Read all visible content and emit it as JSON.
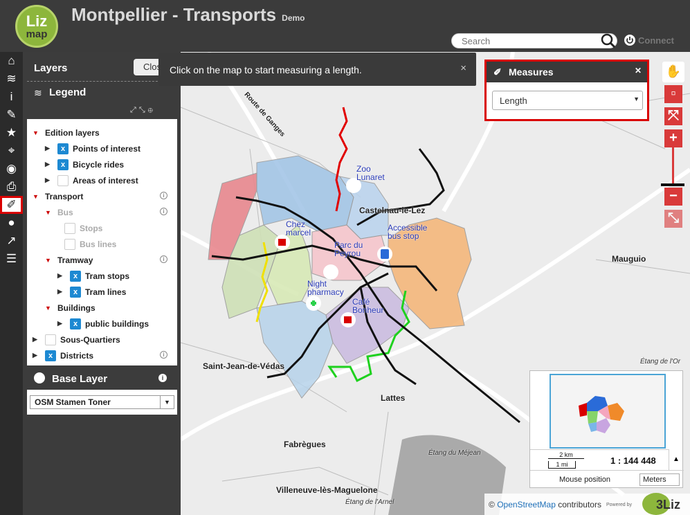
{
  "header": {
    "logo_top": "Liz",
    "logo_bottom": "map",
    "title": "Montpellier - Transports",
    "title_tag": "Demo",
    "search_placeholder": "Search",
    "connect_label": "Connect"
  },
  "toolbar": {
    "items": [
      {
        "icon": "home-icon",
        "glyph": "⌂"
      },
      {
        "icon": "layers-icon",
        "glyph": "≋"
      },
      {
        "icon": "info-icon",
        "glyph": "i"
      },
      {
        "icon": "edit-icon",
        "glyph": "✎"
      },
      {
        "icon": "star-icon",
        "glyph": "★"
      },
      {
        "icon": "locate-icon",
        "glyph": "⌖"
      },
      {
        "icon": "geolocation-icon",
        "glyph": "◉"
      },
      {
        "icon": "print-icon",
        "glyph": "⎙"
      },
      {
        "icon": "measure-icon",
        "glyph": "✐"
      },
      {
        "icon": "comment-icon",
        "glyph": "●"
      },
      {
        "icon": "share-icon",
        "glyph": "↗"
      },
      {
        "icon": "list-icon",
        "glyph": "☰"
      }
    ]
  },
  "panel": {
    "layers_title": "Layers",
    "close_label": "Close",
    "legend_title": "Legend",
    "tree": [
      {
        "label": "Edition layers",
        "indent": 0,
        "tri": "open",
        "checkbox": null,
        "info": false,
        "grey": false
      },
      {
        "label": "Points of interest",
        "indent": 1,
        "tri": "closed",
        "checkbox": true,
        "info": false,
        "grey": false
      },
      {
        "label": "Bicycle rides",
        "indent": 1,
        "tri": "closed",
        "checkbox": true,
        "info": false,
        "grey": false
      },
      {
        "label": "Areas of interest",
        "indent": 1,
        "tri": "closed",
        "checkbox": false,
        "info": false,
        "grey": false
      },
      {
        "label": "Transport",
        "indent": 0,
        "tri": "open",
        "checkbox": null,
        "info": true,
        "grey": false
      },
      {
        "label": "Bus",
        "indent": 1,
        "tri": "open",
        "checkbox": null,
        "info": true,
        "grey": true
      },
      {
        "label": "Stops",
        "indent": 2,
        "tri": "none",
        "checkbox": false,
        "info": false,
        "grey": true
      },
      {
        "label": "Bus lines",
        "indent": 2,
        "tri": "none",
        "checkbox": false,
        "info": false,
        "grey": true
      },
      {
        "label": "Tramway",
        "indent": 1,
        "tri": "open",
        "checkbox": null,
        "info": true,
        "grey": false
      },
      {
        "label": "Tram stops",
        "indent": 2,
        "tri": "closed",
        "checkbox": true,
        "info": false,
        "grey": false
      },
      {
        "label": "Tram lines",
        "indent": 2,
        "tri": "closed",
        "checkbox": true,
        "info": false,
        "grey": false
      },
      {
        "label": "Buildings",
        "indent": 1,
        "tri": "open",
        "checkbox": null,
        "info": false,
        "grey": false
      },
      {
        "label": "public buildings",
        "indent": 2,
        "tri": "closed",
        "checkbox": true,
        "info": false,
        "grey": false
      },
      {
        "label": "Sous-Quartiers",
        "indent": 0,
        "tri": "closed",
        "checkbox": false,
        "info": false,
        "grey": false
      },
      {
        "label": "Districts",
        "indent": 0,
        "tri": "closed",
        "checkbox": true,
        "info": true,
        "grey": false
      }
    ],
    "baselayer_title": "Base Layer",
    "baselayer_value": "OSM Stamen Toner"
  },
  "message": {
    "text": "Click on the map to start measuring a length.",
    "close": "×"
  },
  "measures": {
    "title": "Measures",
    "selected": "Length"
  },
  "map": {
    "labels": [
      {
        "text": "Route de Ganges",
        "kind": "road"
      },
      {
        "text": "Castelnau-le-Lez",
        "kind": "town"
      },
      {
        "text": "Mauguio",
        "kind": "town"
      },
      {
        "text": "Saint-Jean-de-Védas",
        "kind": "town"
      },
      {
        "text": "Lattes",
        "kind": "town"
      },
      {
        "text": "Fabrègues",
        "kind": "town"
      },
      {
        "text": "Villeneuve-lès-Maguelone",
        "kind": "town"
      },
      {
        "text": "Étang du Méjean",
        "kind": "water"
      },
      {
        "text": "Étang de l'Arnel",
        "kind": "water"
      },
      {
        "text": "Étang de l'Or",
        "kind": "water"
      }
    ],
    "pois": [
      {
        "text": "Zoo Lunaret"
      },
      {
        "text": "Chez marcel"
      },
      {
        "text": "Accessible bus stop"
      },
      {
        "text": "Parc du Peyrou"
      },
      {
        "text": "Night pharmacy"
      },
      {
        "text": "Café Bonheur"
      }
    ]
  },
  "overview": {
    "scale_km": "2 km",
    "scale_mi": "1 mi",
    "scale_ratio": "1 : 144 448",
    "mouse_label": "Mouse position",
    "units": "Meters"
  },
  "attribution": {
    "prefix": "©",
    "link": "OpenStreetMap",
    "suffix": "contributors",
    "powered": "Powered by",
    "brand": "3Liz"
  },
  "colors": {
    "accent_red": "#d90000",
    "checkbox_blue": "#1d89d2",
    "lizmap_green": "#8db63c"
  }
}
